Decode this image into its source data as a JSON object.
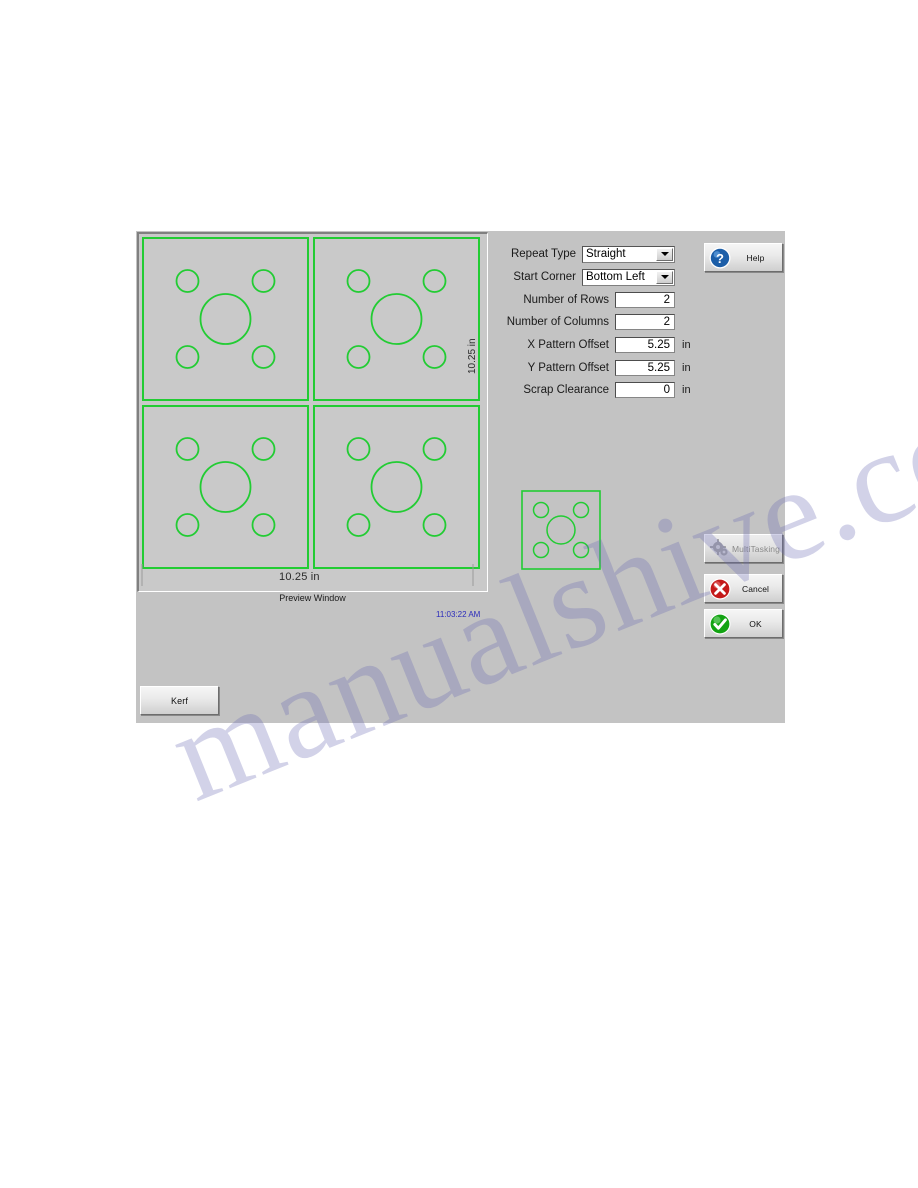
{
  "dialog": {
    "preview": {
      "label": "Preview Window",
      "width_dim": "10.25 in",
      "height_dim": "10.25 in",
      "timestamp": "11:03:22 AM",
      "rows": 2,
      "columns": 2,
      "outline_color": "#22cc33"
    },
    "form": {
      "rows": [
        {
          "label": "Repeat Type",
          "type": "combo",
          "value": "Straight",
          "unit": ""
        },
        {
          "label": "Start Corner",
          "type": "combo",
          "value": "Bottom Left",
          "unit": ""
        },
        {
          "label": "Number of Rows",
          "type": "number",
          "value": "2",
          "unit": ""
        },
        {
          "label": "Number of Columns",
          "type": "number",
          "value": "2",
          "unit": ""
        },
        {
          "label": "X Pattern Offset",
          "type": "number",
          "value": "5.25",
          "unit": "in"
        },
        {
          "label": "Y Pattern Offset",
          "type": "number",
          "value": "5.25",
          "unit": "in"
        },
        {
          "label": "Scrap Clearance",
          "type": "number",
          "value": "0",
          "unit": "in"
        }
      ]
    },
    "buttons": {
      "help": "Help",
      "multitasking": "MultiTasking",
      "cancel": "Cancel",
      "ok": "OK",
      "kerf": "Kerf"
    },
    "colors": {
      "dialog_background": "#c3c3c3",
      "preview_background": "#c9c9c9",
      "geometry_green": "#22cc33",
      "timestamp_blue": "#2b2bbb",
      "help_blue": "#1c5ea8",
      "cancel_red": "#c41a1a",
      "ok_green": "#13a313"
    }
  },
  "watermark": {
    "text": "manualshive.com"
  }
}
